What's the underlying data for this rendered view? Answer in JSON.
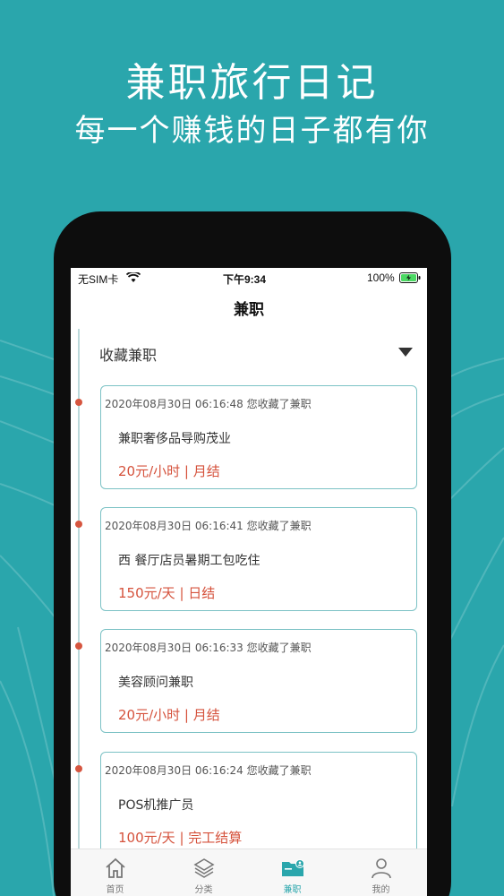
{
  "promo": {
    "headline": "兼职旅行日记",
    "subline": "每一个赚钱的日子都有你"
  },
  "status_bar": {
    "carrier": "无SIM卡",
    "time": "下午9:34",
    "battery": "100%"
  },
  "nav": {
    "title": "兼职"
  },
  "section": {
    "label": "收藏兼职",
    "icon": "triangle-down-icon"
  },
  "records": [
    {
      "timestamp": "2020年08月30日 06:16:48 您收藏了兼职",
      "title": "兼职奢侈品导购茂业",
      "pay": "20元/小时 |  月结"
    },
    {
      "timestamp": "2020年08月30日 06:16:41 您收藏了兼职",
      "title": "西 餐厅店员暑期工包吃住",
      "pay": "150元/天 |  日结"
    },
    {
      "timestamp": "2020年08月30日 06:16:33 您收藏了兼职",
      "title": "美容顾问兼职",
      "pay": "20元/小时 |  月结"
    },
    {
      "timestamp": "2020年08月30日 06:16:24 您收藏了兼职",
      "title": "POS机推广员",
      "pay": "100元/天 |  完工结算"
    }
  ],
  "tabs": [
    {
      "label": "首页",
      "icon": "home-icon"
    },
    {
      "label": "分类",
      "icon": "layers-icon"
    },
    {
      "label": "兼职",
      "icon": "folder-user-icon",
      "active": true
    },
    {
      "label": "我的",
      "icon": "person-icon"
    }
  ],
  "colors": {
    "background": "#2aa6ac",
    "accent": "#2aa6ac",
    "pay_text": "#d5523c",
    "card_border": "#7cc2c5",
    "timeline_dot": "#d6553f"
  }
}
